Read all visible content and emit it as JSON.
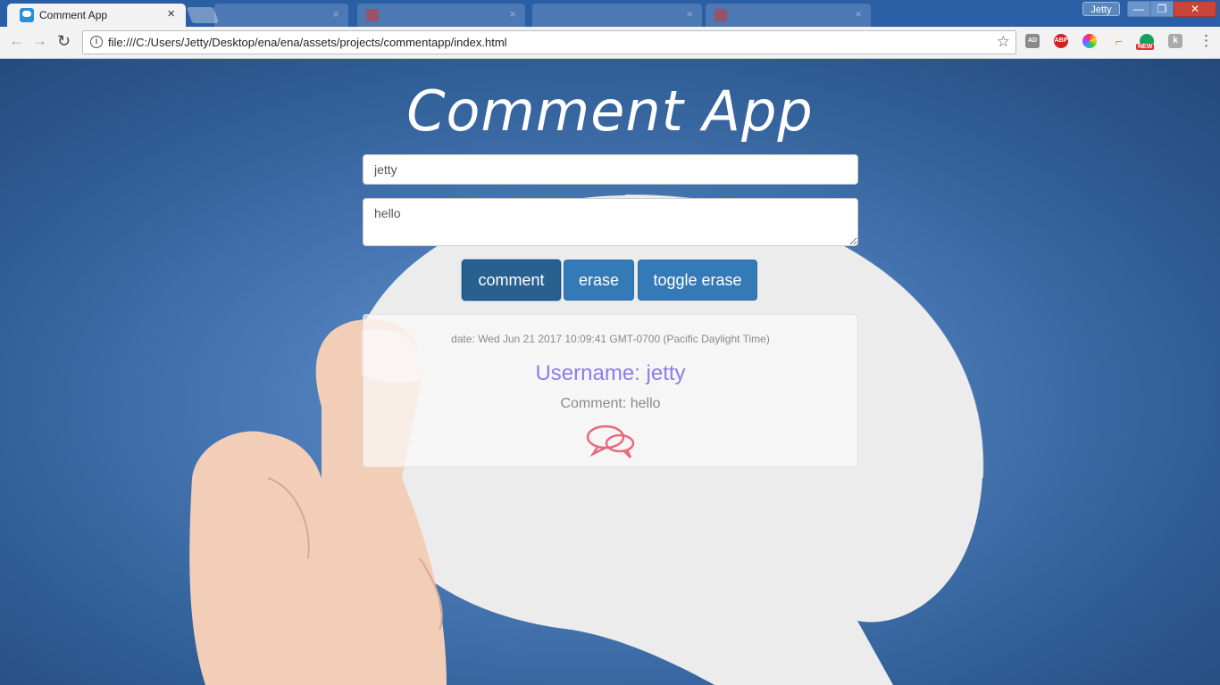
{
  "browser": {
    "active_tab": {
      "title": "Comment App",
      "close": "×"
    },
    "other_tabs": [
      {
        "title": ""
      },
      {
        "title": ""
      },
      {
        "title": ""
      },
      {
        "title": ""
      }
    ],
    "user_badge": "Jetty",
    "window_buttons": {
      "minimize": "—",
      "maximize": "❐",
      "close": "✕"
    },
    "nav": {
      "back": "←",
      "forward": "→",
      "reload": "↻"
    },
    "url": "file:///C:/Users/Jetty/Desktop/ena/ena/assets/projects/commentapp/index.html",
    "info_icon": "i",
    "star_icon": "☆",
    "extensions": {
      "adblock": "AD",
      "abp": "ABP",
      "tool": "⌐",
      "grammar_new": "NEW",
      "k": "k"
    },
    "menu_icon": "⋮"
  },
  "app": {
    "title": "Comment App",
    "form": {
      "username_value": "jetty",
      "comment_value": "hello"
    },
    "buttons": {
      "comment": "comment",
      "erase": "erase",
      "toggle": "toggle erase"
    },
    "comments": [
      {
        "date": "date: Wed Jun 21 2017 10:09:41 GMT-0700 (Pacific Daylight Time)",
        "username": "Username: jetty",
        "comment": "Comment: hello"
      }
    ]
  },
  "colors": {
    "accent": "#337ab7",
    "username": "#8a7ee8",
    "chat_icon": "#e86a7a"
  }
}
